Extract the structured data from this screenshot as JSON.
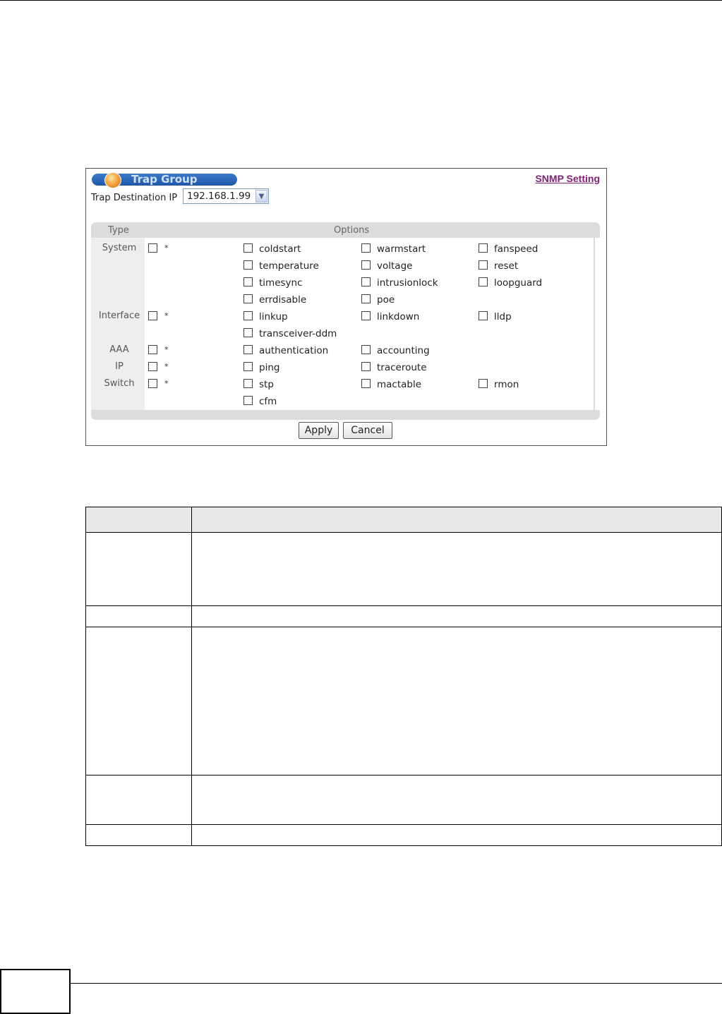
{
  "panel": {
    "title": "Trap Group",
    "snmp_link": "SNMP Setting",
    "dest_label": "Trap Destination IP",
    "dest_value": "192.168.1.99"
  },
  "table": {
    "type_header": "Type",
    "options_header": "Options",
    "star": "*",
    "groups": [
      {
        "type": "System",
        "options": [
          "coldstart",
          "warmstart",
          "fanspeed",
          "temperature",
          "voltage",
          "reset",
          "timesync",
          "intrusionlock",
          "loopguard",
          "errdisable",
          "poe"
        ]
      },
      {
        "type": "Interface",
        "options": [
          "linkup",
          "linkdown",
          "lldp",
          "transceiver-ddm"
        ]
      },
      {
        "type": "AAA",
        "options": [
          "authentication",
          "accounting"
        ]
      },
      {
        "type": "IP",
        "options": [
          "ping",
          "traceroute"
        ]
      },
      {
        "type": "Switch",
        "options": [
          "stp",
          "mactable",
          "rmon",
          "cfm"
        ]
      }
    ]
  },
  "buttons": {
    "apply": "Apply",
    "cancel": "Cancel"
  }
}
